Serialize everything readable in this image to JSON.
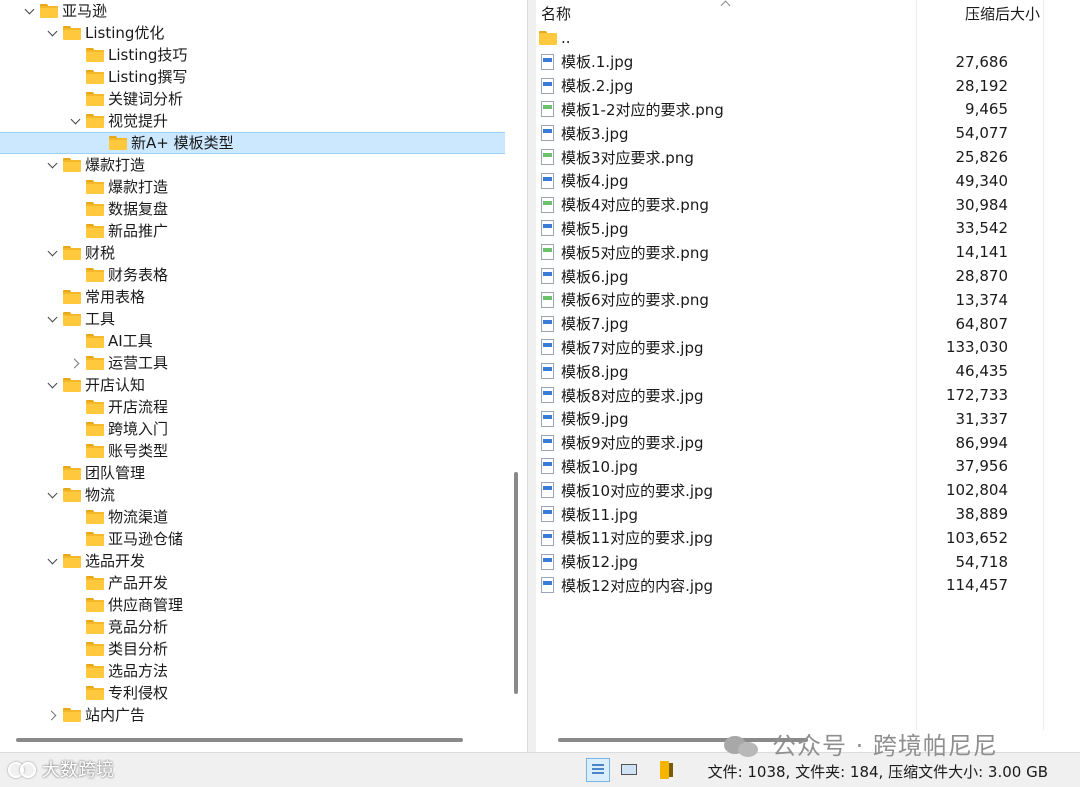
{
  "tree": {
    "items": [
      {
        "label": "亚马逊",
        "level": 0,
        "expander": "down"
      },
      {
        "label": "Listing优化",
        "level": 1,
        "expander": "down"
      },
      {
        "label": "Listing技巧",
        "level": 2,
        "expander": "none"
      },
      {
        "label": "Listing撰写",
        "level": 2,
        "expander": "none"
      },
      {
        "label": "关键词分析",
        "level": 2,
        "expander": "none"
      },
      {
        "label": "视觉提升",
        "level": 2,
        "expander": "down"
      },
      {
        "label": "新A+ 模板类型",
        "level": 3,
        "expander": "none",
        "selected": true
      },
      {
        "label": "爆款打造",
        "level": 1,
        "expander": "down"
      },
      {
        "label": "爆款打造",
        "level": 2,
        "expander": "none"
      },
      {
        "label": "数据复盘",
        "level": 2,
        "expander": "none"
      },
      {
        "label": "新品推广",
        "level": 2,
        "expander": "none"
      },
      {
        "label": "财税",
        "level": 1,
        "expander": "down"
      },
      {
        "label": "财务表格",
        "level": 2,
        "expander": "none"
      },
      {
        "label": "常用表格",
        "level": 1,
        "expander": "none"
      },
      {
        "label": "工具",
        "level": 1,
        "expander": "down"
      },
      {
        "label": "AI工具",
        "level": 2,
        "expander": "none"
      },
      {
        "label": "运营工具",
        "level": 2,
        "expander": "right"
      },
      {
        "label": "开店认知",
        "level": 1,
        "expander": "down"
      },
      {
        "label": "开店流程",
        "level": 2,
        "expander": "none"
      },
      {
        "label": "跨境入门",
        "level": 2,
        "expander": "none"
      },
      {
        "label": "账号类型",
        "level": 2,
        "expander": "none"
      },
      {
        "label": "团队管理",
        "level": 1,
        "expander": "none"
      },
      {
        "label": "物流",
        "level": 1,
        "expander": "down"
      },
      {
        "label": "物流渠道",
        "level": 2,
        "expander": "none"
      },
      {
        "label": "亚马逊仓储",
        "level": 2,
        "expander": "none"
      },
      {
        "label": "选品开发",
        "level": 1,
        "expander": "down"
      },
      {
        "label": "产品开发",
        "level": 2,
        "expander": "none"
      },
      {
        "label": "供应商管理",
        "level": 2,
        "expander": "none"
      },
      {
        "label": "竞品分析",
        "level": 2,
        "expander": "none"
      },
      {
        "label": "类目分析",
        "level": 2,
        "expander": "none"
      },
      {
        "label": "选品方法",
        "level": 2,
        "expander": "none"
      },
      {
        "label": "专利侵权",
        "level": 2,
        "expander": "none"
      },
      {
        "label": "站内广告",
        "level": 1,
        "expander": "right"
      }
    ]
  },
  "list": {
    "header": {
      "name": "名称",
      "size": "压缩后大小"
    },
    "files": [
      {
        "name": "..",
        "size": "",
        "type": "up"
      },
      {
        "name": "模板.1.jpg",
        "size": "27,686",
        "type": "jpg"
      },
      {
        "name": "模板.2.jpg",
        "size": "28,192",
        "type": "jpg"
      },
      {
        "name": "模板1-2对应的要求.png",
        "size": "9,465",
        "type": "png"
      },
      {
        "name": "模板3.jpg",
        "size": "54,077",
        "type": "jpg"
      },
      {
        "name": "模板3对应要求.png",
        "size": "25,826",
        "type": "png"
      },
      {
        "name": "模板4.jpg",
        "size": "49,340",
        "type": "jpg"
      },
      {
        "name": "模板4对应的要求.png",
        "size": "30,984",
        "type": "png"
      },
      {
        "name": "模板5.jpg",
        "size": "33,542",
        "type": "jpg"
      },
      {
        "name": "模板5对应的要求.png",
        "size": "14,141",
        "type": "png"
      },
      {
        "name": "模板6.jpg",
        "size": "28,870",
        "type": "jpg"
      },
      {
        "name": "模板6对应的要求.png",
        "size": "13,374",
        "type": "png"
      },
      {
        "name": "模板7.jpg",
        "size": "64,807",
        "type": "jpg"
      },
      {
        "name": "模板7对应的要求.jpg",
        "size": "133,030",
        "type": "jpg"
      },
      {
        "name": "模板8.jpg",
        "size": "46,435",
        "type": "jpg"
      },
      {
        "name": "模板8对应的要求.jpg",
        "size": "172,733",
        "type": "jpg"
      },
      {
        "name": "模板9.jpg",
        "size": "31,337",
        "type": "jpg"
      },
      {
        "name": "模板9对应的要求.jpg",
        "size": "86,994",
        "type": "jpg"
      },
      {
        "name": "模板10.jpg",
        "size": "37,956",
        "type": "jpg"
      },
      {
        "name": "模板10对应的要求.jpg",
        "size": "102,804",
        "type": "jpg"
      },
      {
        "name": "模板11.jpg",
        "size": "38,889",
        "type": "jpg"
      },
      {
        "name": "模板11对应的要求.jpg",
        "size": "103,652",
        "type": "jpg"
      },
      {
        "name": "模板12.jpg",
        "size": "54,718",
        "type": "jpg"
      },
      {
        "name": "模板12对应的内容.jpg",
        "size": "114,457",
        "type": "jpg"
      }
    ]
  },
  "status": {
    "summary": "文件: 1038, 文件夹: 184, 压缩文件大小: 3.00 GB"
  },
  "watermarks": {
    "left": "大数跨境",
    "right": "公众号 · 跨境帕尼尼"
  }
}
